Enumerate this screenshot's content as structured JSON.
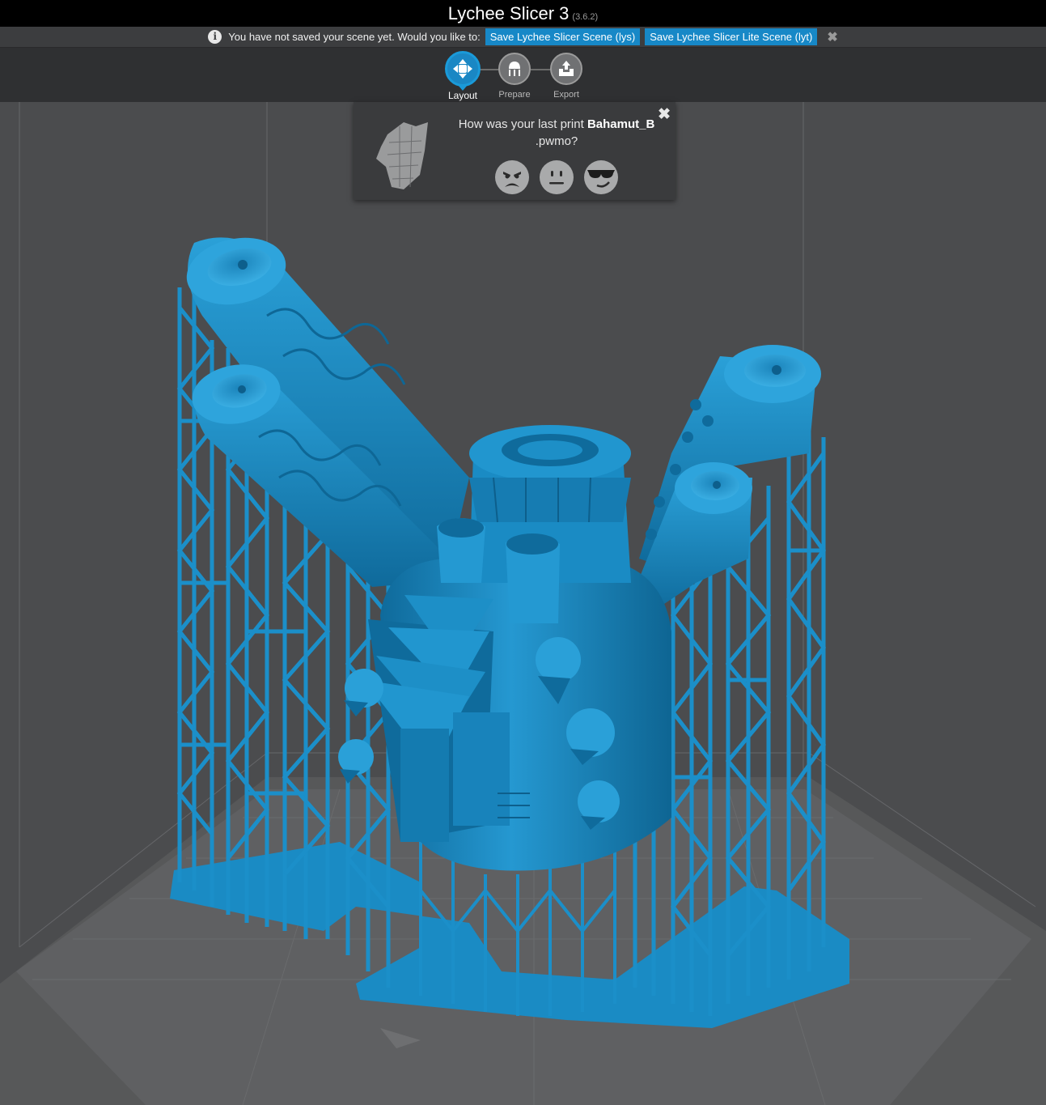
{
  "window": {
    "title": "Lychee Slicer 3",
    "version": "(3.6.2)"
  },
  "notice": {
    "message": "You have not saved your scene yet. Would you like to:",
    "save_lys_label": "Save Lychee Slicer Scene (lys)",
    "save_lyt_label": "Save Lychee Slicer Lite Scene (lyt)",
    "close_glyph": "✖"
  },
  "workflow": {
    "steps": [
      {
        "label": "Layout",
        "icon": "move-arrows-icon",
        "active": true
      },
      {
        "label": "Prepare",
        "icon": "supports-icon",
        "active": false
      },
      {
        "label": "Export",
        "icon": "export-box-icon",
        "active": false
      }
    ]
  },
  "feedback_popup": {
    "question_prefix": "How was your last print",
    "file_name": "Bahamut_B",
    "file_ext": ".pwmo?",
    "close_glyph": "✖",
    "faces": [
      "angry-face-icon",
      "neutral-face-icon",
      "cool-face-icon"
    ]
  },
  "colors": {
    "model": "#1a8bc4",
    "model_shadow": "#0d5f8c",
    "accent": "#1788c7",
    "viewport_bg": "#4b4c4e",
    "build_plate": "#5f6062"
  }
}
